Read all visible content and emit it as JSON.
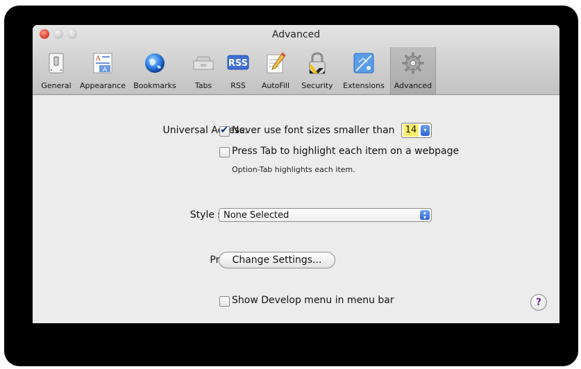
{
  "window": {
    "title": "Advanced"
  },
  "toolbar": {
    "items": [
      {
        "label": "General",
        "icon": "switch-icon"
      },
      {
        "label": "Appearance",
        "icon": "appearance-icon"
      },
      {
        "label": "Bookmarks",
        "icon": "globe-icon"
      },
      {
        "label": "Tabs",
        "icon": "tabs-icon"
      },
      {
        "label": "RSS",
        "icon": "rss-icon"
      },
      {
        "label": "AutoFill",
        "icon": "pencil-icon"
      },
      {
        "label": "Security",
        "icon": "lock-icon"
      },
      {
        "label": "Extensions",
        "icon": "puzzle-icon"
      },
      {
        "label": "Advanced",
        "icon": "gear-icon",
        "selected": true
      }
    ],
    "rss_badge": "RSS"
  },
  "universal_access": {
    "label": "Universal Access:",
    "min_font_checkbox_checked": true,
    "min_font_text": "Never use font sizes smaller than",
    "min_font_size": "14",
    "tab_highlight_checked": false,
    "tab_highlight_text": "Press Tab to highlight each item on a webpage",
    "tab_note": "Option-Tab highlights each item."
  },
  "style_sheet": {
    "label": "Style sheet:",
    "value": "None Selected"
  },
  "proxies": {
    "label": "Proxies:",
    "button": "Change Settings..."
  },
  "develop": {
    "checked": false,
    "text": "Show Develop menu in menu bar"
  },
  "help": {
    "symbol": "?"
  },
  "colors": {
    "accent_blue": "#2d64cf",
    "highlight_yellow": "#fff06e"
  }
}
